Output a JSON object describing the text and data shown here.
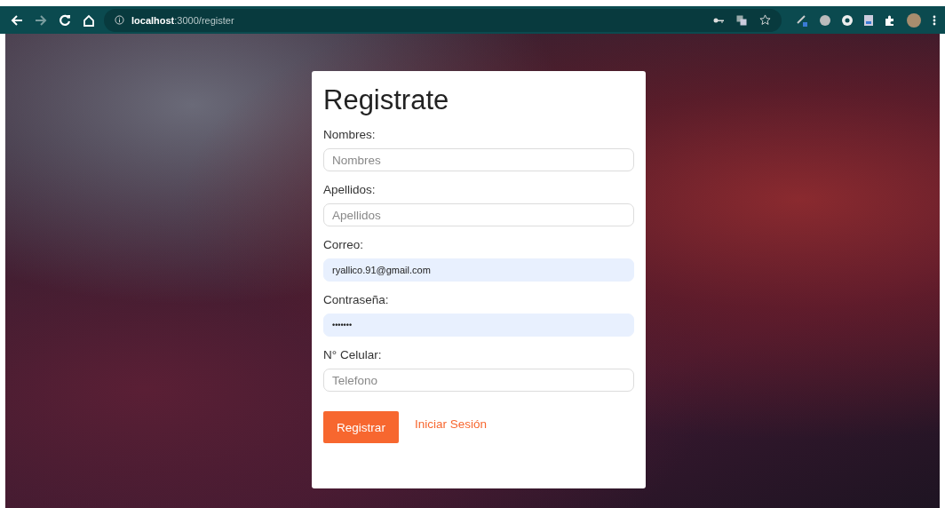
{
  "browser": {
    "url": "**localhost**:3000/register",
    "back_disabled": false,
    "forward_disabled": true
  },
  "form": {
    "title": "Registrate",
    "fields": [
      {
        "label": "Nombres:",
        "kind": "text",
        "placeholder": "Nombres",
        "autofilled": false
      },
      {
        "label": "Apellidos:",
        "kind": "text",
        "placeholder": "Apellidos",
        "autofilled": false
      },
      {
        "label": "Correo:",
        "kind": "email",
        "value": "ryallico.91@gmail.com",
        "autofilled": true
      },
      {
        "label": "Contraseña:",
        "kind": "password",
        "value": "•••••••",
        "autofilled": true
      },
      {
        "label": "N° Celular:",
        "kind": "tel",
        "placeholder": "Telefono",
        "autofilled": false
      }
    ],
    "submit": "Registrar",
    "link": "Iniciar Sesión"
  }
}
